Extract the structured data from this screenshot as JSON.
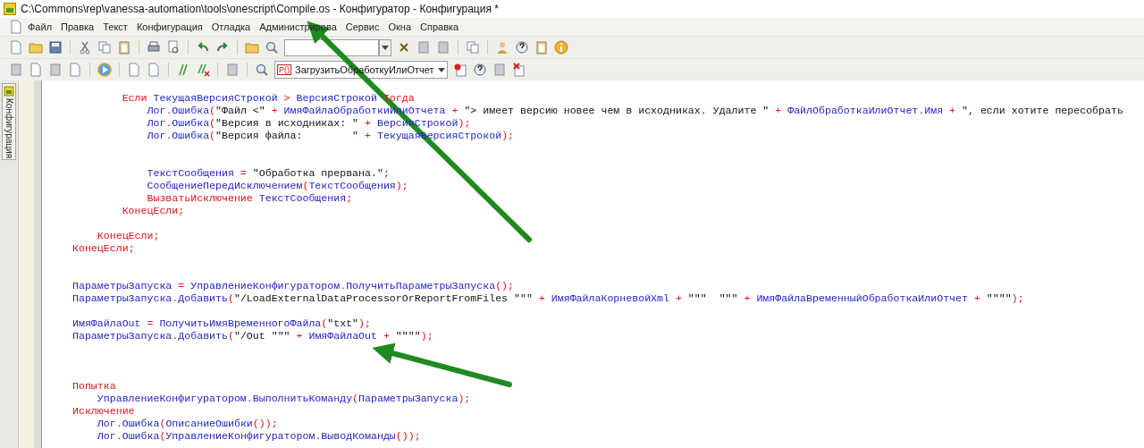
{
  "window": {
    "title": "C:\\Commons\\rep\\vanessa-automation\\tools\\onescript\\Compile.os - Конфигуратор - Конфигурация *"
  },
  "menu": [
    "Файл",
    "Правка",
    "Текст",
    "Конфигурация",
    "Отладка",
    "Администрирова",
    "Сервис",
    "Окна",
    "Справка"
  ],
  "run_combo": {
    "badge": "P()",
    "value": "ЗагрузитьОбработкуИлиОтчет"
  },
  "side_panel": {
    "tab": "Конфигурация"
  },
  "editor": {
    "lines": [
      {
        "kind": "code",
        "tokens": [
          {
            "kind": "kw",
            "text": "        Если "
          },
          {
            "kind": "id",
            "text": "ТекущаяВерсияСтрокой"
          },
          {
            "kind": "op",
            "text": " > "
          },
          {
            "kind": "id",
            "text": "ВерсияСтрокой"
          },
          {
            "kind": "kw",
            "text": " Тогда"
          }
        ]
      },
      {
        "kind": "code",
        "tokens": [
          {
            "kind": "id",
            "text": "            Лог"
          },
          {
            "kind": "op",
            "text": "."
          },
          {
            "kind": "id",
            "text": "Ошибка"
          },
          {
            "kind": "op",
            "text": "("
          },
          {
            "kind": "str",
            "text": "\"Файл <\""
          },
          {
            "kind": "op",
            "text": " + "
          },
          {
            "kind": "id",
            "text": "ИмяФайлаОбработкиИлиОтчета"
          },
          {
            "kind": "op",
            "text": " + "
          },
          {
            "kind": "str",
            "text": "\"> имеет версию новее чем в исходниках. Удалите \""
          },
          {
            "kind": "op",
            "text": " + "
          },
          {
            "kind": "id",
            "text": "ФайлОбработкаИлиОтчет"
          },
          {
            "kind": "op",
            "text": "."
          },
          {
            "kind": "id",
            "text": "Имя"
          },
          {
            "kind": "op",
            "text": " + "
          },
          {
            "kind": "str",
            "text": "\", если хотите пересобрать"
          }
        ]
      },
      {
        "kind": "code",
        "tokens": [
          {
            "kind": "id",
            "text": "            Лог"
          },
          {
            "kind": "op",
            "text": "."
          },
          {
            "kind": "id",
            "text": "Ошибка"
          },
          {
            "kind": "op",
            "text": "("
          },
          {
            "kind": "str",
            "text": "\"Версия в исходниках: \""
          },
          {
            "kind": "op",
            "text": " + "
          },
          {
            "kind": "id",
            "text": "ВерсияСтрокой"
          },
          {
            "kind": "op",
            "text": ");"
          }
        ]
      },
      {
        "kind": "code",
        "tokens": [
          {
            "kind": "id",
            "text": "            Лог"
          },
          {
            "kind": "op",
            "text": "."
          },
          {
            "kind": "id",
            "text": "Ошибка"
          },
          {
            "kind": "op",
            "text": "("
          },
          {
            "kind": "str",
            "text": "\"Версия файла:        \""
          },
          {
            "kind": "op",
            "text": " + "
          },
          {
            "kind": "id",
            "text": "ТекущаяВерсияСтрокой"
          },
          {
            "kind": "op",
            "text": ");"
          }
        ]
      },
      {
        "kind": "blank"
      },
      {
        "kind": "blank"
      },
      {
        "kind": "code",
        "tokens": [
          {
            "kind": "id",
            "text": "            ТекстСообщения"
          },
          {
            "kind": "op",
            "text": " = "
          },
          {
            "kind": "str",
            "text": "\"Обработка прервана.\""
          },
          {
            "kind": "op",
            "text": ";"
          }
        ]
      },
      {
        "kind": "code",
        "tokens": [
          {
            "kind": "id",
            "text": "            СообщениеПередИсключением"
          },
          {
            "kind": "op",
            "text": "("
          },
          {
            "kind": "id",
            "text": "ТекстСообщения"
          },
          {
            "kind": "op",
            "text": ");"
          }
        ]
      },
      {
        "kind": "code",
        "tokens": [
          {
            "kind": "kw",
            "text": "            ВызватьИсключение "
          },
          {
            "kind": "id",
            "text": "ТекстСообщения"
          },
          {
            "kind": "op",
            "text": ";"
          }
        ]
      },
      {
        "kind": "code",
        "tokens": [
          {
            "kind": "kw",
            "text": "        КонецЕсли"
          },
          {
            "kind": "op",
            "text": ";"
          }
        ]
      },
      {
        "kind": "blank"
      },
      {
        "kind": "code",
        "tokens": [
          {
            "kind": "kw",
            "text": "    КонецЕсли"
          },
          {
            "kind": "op",
            "text": ";"
          }
        ]
      },
      {
        "kind": "code",
        "tokens": [
          {
            "kind": "kw",
            "text": "КонецЕсли"
          },
          {
            "kind": "op",
            "text": ";"
          }
        ]
      },
      {
        "kind": "blank"
      },
      {
        "kind": "blank"
      },
      {
        "kind": "code",
        "tokens": [
          {
            "kind": "id",
            "text": "ПараметрыЗапуска"
          },
          {
            "kind": "op",
            "text": " = "
          },
          {
            "kind": "id",
            "text": "УправлениеКонфигуратором"
          },
          {
            "kind": "op",
            "text": "."
          },
          {
            "kind": "id",
            "text": "ПолучитьПараметрыЗапуска"
          },
          {
            "kind": "op",
            "text": "();"
          }
        ]
      },
      {
        "kind": "code",
        "tokens": [
          {
            "kind": "id",
            "text": "ПараметрыЗапуска"
          },
          {
            "kind": "op",
            "text": "."
          },
          {
            "kind": "id",
            "text": "Добавить"
          },
          {
            "kind": "op",
            "text": "("
          },
          {
            "kind": "str",
            "text": "\"/LoadExternalDataProcessorOrReportFromFiles \"\"\""
          },
          {
            "kind": "op",
            "text": " + "
          },
          {
            "kind": "id",
            "text": "ИмяФайлаКорневойXml"
          },
          {
            "kind": "op",
            "text": " + "
          },
          {
            "kind": "str",
            "text": "\"\"\"  \"\"\""
          },
          {
            "kind": "op",
            "text": " + "
          },
          {
            "kind": "id",
            "text": "ИмяФайлаВременныйОбработкаИлиОтчет"
          },
          {
            "kind": "op",
            "text": " + "
          },
          {
            "kind": "str",
            "text": "\"\"\"\""
          },
          {
            "kind": "op",
            "text": ");"
          }
        ]
      },
      {
        "kind": "blank"
      },
      {
        "kind": "code",
        "tokens": [
          {
            "kind": "id",
            "text": "ИмяФайлаOut"
          },
          {
            "kind": "op",
            "text": " = "
          },
          {
            "kind": "id",
            "text": "ПолучитьИмяВременногоФайла"
          },
          {
            "kind": "op",
            "text": "("
          },
          {
            "kind": "str",
            "text": "\"txt\""
          },
          {
            "kind": "op",
            "text": ");"
          }
        ]
      },
      {
        "kind": "code",
        "tokens": [
          {
            "kind": "id",
            "text": "ПараметрыЗапуска"
          },
          {
            "kind": "op",
            "text": "."
          },
          {
            "kind": "id",
            "text": "Добавить"
          },
          {
            "kind": "op",
            "text": "("
          },
          {
            "kind": "str",
            "text": "\"/Out \"\"\""
          },
          {
            "kind": "op",
            "text": " + "
          },
          {
            "kind": "id",
            "text": "ИмяФайлаOut"
          },
          {
            "kind": "op",
            "text": " + "
          },
          {
            "kind": "str",
            "text": "\"\"\"\""
          },
          {
            "kind": "op",
            "text": ");"
          }
        ]
      },
      {
        "kind": "blank"
      },
      {
        "kind": "blank"
      },
      {
        "kind": "blank"
      },
      {
        "kind": "code",
        "tokens": [
          {
            "kind": "kw",
            "text": "Попытка"
          }
        ]
      },
      {
        "kind": "code",
        "tokens": [
          {
            "kind": "id",
            "text": "    УправлениеКонфигуратором"
          },
          {
            "kind": "op",
            "text": "."
          },
          {
            "kind": "id",
            "text": "ВыполнитьКоманду"
          },
          {
            "kind": "op",
            "text": "("
          },
          {
            "kind": "id",
            "text": "ПараметрыЗапуска"
          },
          {
            "kind": "op",
            "text": ");"
          }
        ]
      },
      {
        "kind": "code",
        "tokens": [
          {
            "kind": "kw",
            "text": "Исключение"
          }
        ]
      },
      {
        "kind": "code",
        "tokens": [
          {
            "kind": "id",
            "text": "    Лог"
          },
          {
            "kind": "op",
            "text": "."
          },
          {
            "kind": "id",
            "text": "Ошибка"
          },
          {
            "kind": "op",
            "text": "("
          },
          {
            "kind": "id",
            "text": "ОписаниеОшибки"
          },
          {
            "kind": "op",
            "text": "());"
          }
        ]
      },
      {
        "kind": "code",
        "tokens": [
          {
            "kind": "id",
            "text": "    Лог"
          },
          {
            "kind": "op",
            "text": "."
          },
          {
            "kind": "id",
            "text": "Ошибка"
          },
          {
            "kind": "op",
            "text": "("
          },
          {
            "kind": "id",
            "text": "УправлениеКонфигуратором"
          },
          {
            "kind": "op",
            "text": "."
          },
          {
            "kind": "id",
            "text": "ВыводКоманды"
          },
          {
            "kind": "op",
            "text": "());"
          }
        ]
      }
    ]
  }
}
